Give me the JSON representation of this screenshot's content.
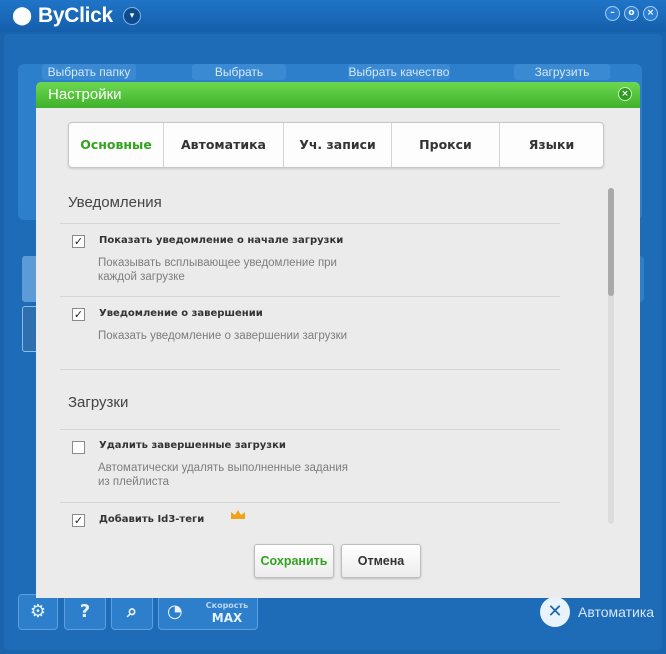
{
  "app": {
    "title": "ByClick",
    "menu_glyph": "▾",
    "window_controls": [
      "–",
      "o",
      "×"
    ],
    "steps": [
      "Выбрать папку",
      "Выбрать формат",
      "Выбрать качество",
      "Загрузить"
    ],
    "toolbar": {
      "settings_glyph": "⚙",
      "help_glyph": "?",
      "search_glyph": "⌕",
      "speed_glyph": "◔",
      "speed_label": "Скорость",
      "speed_value": "MAX"
    },
    "auto_label": "Автоматика"
  },
  "dialog": {
    "title": "Настройки",
    "close_glyph": "×",
    "tabs": [
      {
        "label": "Основные",
        "active": true
      },
      {
        "label": "Автоматика",
        "active": false
      },
      {
        "label": "Уч. записи",
        "active": false
      },
      {
        "label": "Прокси",
        "active": false
      },
      {
        "label": "Языки",
        "active": false
      }
    ],
    "sections": [
      {
        "title": "Уведомления",
        "options": [
          {
            "label": "Показать уведомление о начале загрузки",
            "description": "Показывать всплывающее уведомление при каждой загрузке",
            "checked": true
          },
          {
            "label": "Уведомление о завершении",
            "description": "Показать уведомление о завершении загрузки",
            "checked": true
          }
        ]
      },
      {
        "title": "Загрузки",
        "options": [
          {
            "label": "Удалить завершенные загрузки",
            "description": "Автоматически удалять выполненные задания из плейлиста",
            "checked": false
          },
          {
            "label": "Добавить Id3-теги",
            "description": "",
            "checked": true,
            "premium": true
          }
        ]
      }
    ],
    "buttons": {
      "save": "Сохранить",
      "cancel": "Отмена"
    },
    "colors": {
      "accent": "#33a31f",
      "title_bar": "#4cbf33",
      "crown": "#f0a21b"
    }
  }
}
